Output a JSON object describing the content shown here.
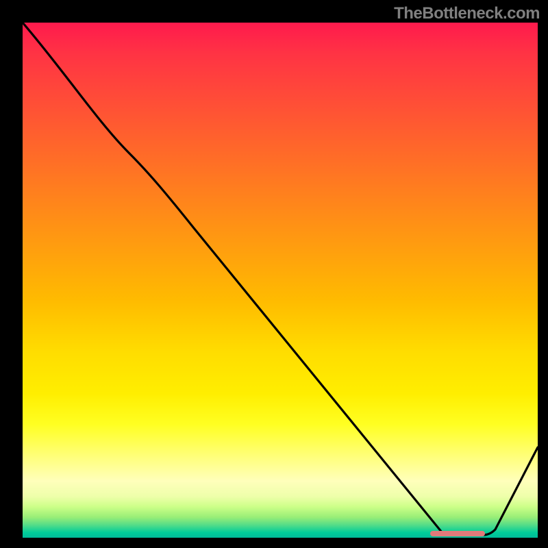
{
  "watermark": "TheBottleneck.com",
  "chart_data": {
    "type": "line",
    "title": "",
    "xlabel": "",
    "ylabel": "",
    "xlim": [
      0,
      100
    ],
    "ylim": [
      0,
      100
    ],
    "x": [
      0,
      20,
      82,
      90,
      100
    ],
    "values": [
      100,
      75,
      0,
      0,
      18
    ],
    "marker_segment": {
      "x_start": 80,
      "x_end": 90,
      "y": 0.5,
      "color": "#e07070"
    },
    "notes": "Heat-gradient background from red (top) to green (bottom); black curve descending to a minimum around x≈82–90 then rising; short salmon marker near the minimum."
  }
}
